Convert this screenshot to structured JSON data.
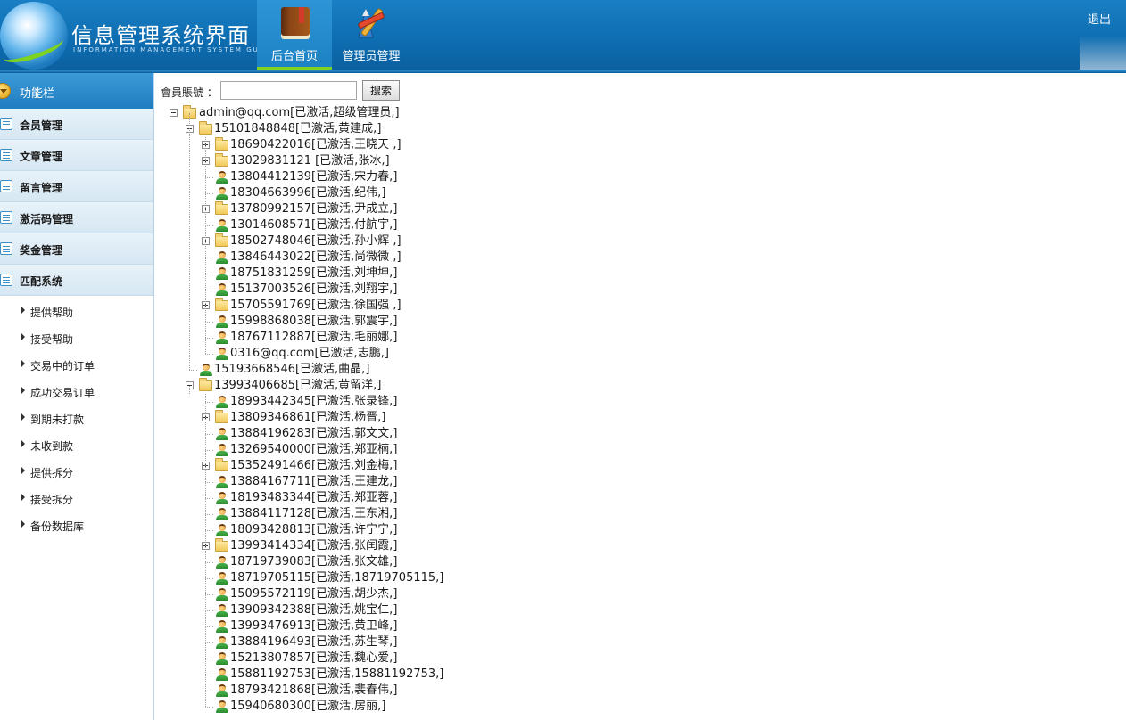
{
  "header": {
    "title": "信息管理系统界面",
    "subtitle": "INFORMATION MANAGEMENT SYSTEM GUI",
    "nav": [
      {
        "label": "后台首页",
        "icon": "book-icon",
        "active": true
      },
      {
        "label": "管理员管理",
        "icon": "tools-icon",
        "active": false
      }
    ],
    "logout_label": "退出"
  },
  "sidebar": {
    "title": "功能栏",
    "menu": [
      {
        "label": "会员管理",
        "icon": "list-icon"
      },
      {
        "label": "文章管理",
        "icon": "edit-icon"
      },
      {
        "label": "留言管理",
        "icon": "edit-icon"
      },
      {
        "label": "激活码管理",
        "icon": "calendar-icon"
      },
      {
        "label": "奖金管理",
        "icon": "calendar-icon"
      },
      {
        "label": "匹配系统",
        "icon": "calendar-icon"
      }
    ],
    "submenu": [
      {
        "label": "提供帮助"
      },
      {
        "label": "接受帮助"
      },
      {
        "label": "交易中的订单"
      },
      {
        "label": "成功交易订单"
      },
      {
        "label": "到期未打款"
      },
      {
        "label": "未收到款"
      },
      {
        "label": "提供拆分"
      },
      {
        "label": "接受拆分"
      },
      {
        "label": "备份数据库"
      }
    ]
  },
  "search": {
    "label": "會員賬號 ：",
    "value": "",
    "button_label": "搜索"
  },
  "tree": [
    {
      "label": "admin@qq.com[已激活,超级管理员,]",
      "level": 0,
      "type": "folder",
      "toggle": "minus"
    },
    {
      "label": "15101848848[已激活,黄建成,]",
      "level": 1,
      "type": "folder",
      "toggle": "minus"
    },
    {
      "label": "18690422016[已激活,王晓天 ,]",
      "level": 2,
      "type": "folder",
      "toggle": "plus"
    },
    {
      "label": "13029831121 [已激活,张冰,]",
      "level": 2,
      "type": "folder",
      "toggle": "plus"
    },
    {
      "label": "13804412139[已激活,宋力春,]",
      "level": 2,
      "type": "user",
      "toggle": "none"
    },
    {
      "label": "18304663996[已激活,纪伟,]",
      "level": 2,
      "type": "user",
      "toggle": "none"
    },
    {
      "label": "13780992157[已激活,尹成立,]",
      "level": 2,
      "type": "folder",
      "toggle": "plus"
    },
    {
      "label": "13014608571[已激活,付航宇,]",
      "level": 2,
      "type": "user",
      "toggle": "none"
    },
    {
      "label": "18502748046[已激活,孙小辉 ,]",
      "level": 2,
      "type": "folder",
      "toggle": "plus"
    },
    {
      "label": "13846443022[已激活,尚微微 ,]",
      "level": 2,
      "type": "user",
      "toggle": "none"
    },
    {
      "label": "18751831259[已激活,刘坤坤,]",
      "level": 2,
      "type": "user",
      "toggle": "none"
    },
    {
      "label": "15137003526[已激活,刘翔宇,]",
      "level": 2,
      "type": "user",
      "toggle": "none"
    },
    {
      "label": "15705591769[已激活,徐国强 ,]",
      "level": 2,
      "type": "folder",
      "toggle": "plus"
    },
    {
      "label": "15998868038[已激活,郭震宇,]",
      "level": 2,
      "type": "user",
      "toggle": "none"
    },
    {
      "label": "18767112887[已激活,毛丽娜,]",
      "level": 2,
      "type": "user",
      "toggle": "none"
    },
    {
      "label": "0316@qq.com[已激活,志鹏,]",
      "level": 2,
      "type": "user",
      "toggle": "none"
    },
    {
      "label": "15193668546[已激活,曲晶,]",
      "level": 1,
      "type": "user",
      "toggle": "none"
    },
    {
      "label": "13993406685[已激活,黄留洋,]",
      "level": 1,
      "type": "folder",
      "toggle": "minus"
    },
    {
      "label": "18993442345[已激活,张录锋,]",
      "level": 2,
      "type": "user",
      "toggle": "none"
    },
    {
      "label": "13809346861[已激活,杨晋,]",
      "level": 2,
      "type": "folder",
      "toggle": "plus"
    },
    {
      "label": "13884196283[已激活,郭文文,]",
      "level": 2,
      "type": "user",
      "toggle": "none"
    },
    {
      "label": "13269540000[已激活,郑亚楠,]",
      "level": 2,
      "type": "user",
      "toggle": "none"
    },
    {
      "label": "15352491466[已激活,刘金梅,]",
      "level": 2,
      "type": "folder",
      "toggle": "plus"
    },
    {
      "label": "13884167711[已激活,王建龙,]",
      "level": 2,
      "type": "user",
      "toggle": "none"
    },
    {
      "label": "18193483344[已激活,郑亚蓉,]",
      "level": 2,
      "type": "user",
      "toggle": "none"
    },
    {
      "label": "13884117128[已激活,王东湘,]",
      "level": 2,
      "type": "user",
      "toggle": "none"
    },
    {
      "label": "18093428813[已激活,许宁宁,]",
      "level": 2,
      "type": "user",
      "toggle": "none"
    },
    {
      "label": "13993414334[已激活,张闰霞,]",
      "level": 2,
      "type": "folder",
      "toggle": "plus"
    },
    {
      "label": "18719739083[已激活,张文雄,]",
      "level": 2,
      "type": "user",
      "toggle": "none"
    },
    {
      "label": "18719705115[已激活,18719705115,]",
      "level": 2,
      "type": "user",
      "toggle": "none"
    },
    {
      "label": "15095572119[已激活,胡少杰,]",
      "level": 2,
      "type": "user",
      "toggle": "none"
    },
    {
      "label": "13909342388[已激活,姚宝仁,]",
      "level": 2,
      "type": "user",
      "toggle": "none"
    },
    {
      "label": "13993476913[已激活,黄卫峰,]",
      "level": 2,
      "type": "user",
      "toggle": "none"
    },
    {
      "label": "13884196493[已激活,苏生琴,]",
      "level": 2,
      "type": "user",
      "toggle": "none"
    },
    {
      "label": "15213807857[已激活,魏心爱,]",
      "level": 2,
      "type": "user",
      "toggle": "none"
    },
    {
      "label": "15881192753[已激活,15881192753,]",
      "level": 2,
      "type": "user",
      "toggle": "none"
    },
    {
      "label": "18793421868[已激活,裴春伟,]",
      "level": 2,
      "type": "user",
      "toggle": "none"
    },
    {
      "label": "15940680300[已激活,房丽,]",
      "level": 2,
      "type": "user",
      "toggle": "none"
    }
  ]
}
